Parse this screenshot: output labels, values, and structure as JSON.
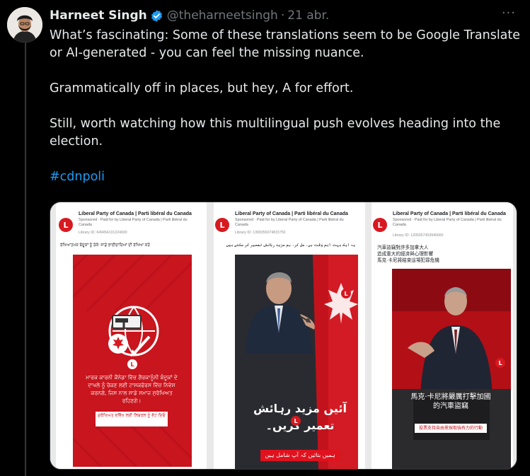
{
  "tweet": {
    "display_name": "Harneet Singh",
    "handle": "@theharneetsingh",
    "separator": "·",
    "time": "21 abr.",
    "more_icon": "···",
    "paragraphs": [
      "What’s fascinating: Some of these translations seem to be Google Translate or AI-generated - you can feel the missing nuance.",
      "Grammatically off in places, but hey, A for effort.",
      "Still, worth watching how this multilingual push evolves heading into the election."
    ],
    "hashtag": "#cdnpoli"
  },
  "ads": [
    {
      "advertiser": "Liberal Party of Canada | Parti libéral du Canada",
      "sponsored": "Sponsored · Paid for by Liberal Party of Canada | Parti libéral du Canada",
      "library_id": "Library ID: 649454101224000",
      "caption": "ਰੱਖਿਆਤਮਕ ਬੰਦੂਕਾਂ ਨੂੰ ਰੋਕੋ: ਸਾਡੇ ਭਾਈਚਾਰਿਆਂ ਦੀ ਰੱਖਿਆ ਕਰੋ",
      "creative_text": "ਮਾਰਕ ਕਾਰਨੀ ਕੈਨੇਡਾ ਵਿੱਚ ਗੈਰਕਾਨੂੰਨੀ ਬੰਦੂਕਾਂ ਦੇ ਦਾਖਲੇ ਨੂੰ ਰੋਕਣ ਲਈ ਟਾਸਕਫੋਰਸ ਵਿੱਚ ਨਿਵੇਸ਼ ਕਰਨਗੇ, ਜਿਸ ਨਾਲ ਸਾਡੇ ਸਮਾਜ ਸੁਰੱਖਿਅਤ ਰਹਿਣਗੇ।",
      "button_text": "ਸੁਰੱਖਿਅਤ ਭਵਿੱਖ ਲਈ ਲਿਬਰਲ ਨੂੰ ਵੋਟ ਦਿਓ"
    },
    {
      "advertiser": "Liberal Party of Canada | Parti libéral du Canada",
      "sponsored": "Sponsored · Paid for by Liberal Party of Canada | Parti libéral du Canada",
      "library_id": "Library ID: 1399356074815750",
      "caption": "یہ ایک بہت اہم وقت ہے۔ مل کر، ہم مزید رہائش تعمیر کر سکتے ہیں",
      "creative_text": "آئیں مزید رہائش تعمیر کریں۔",
      "button_text": "ہمیں بتائیں کہ آپ شامل ہیں"
    },
    {
      "advertiser": "Liberal Party of Canada | Parti libéral du Canada",
      "sponsored": "Sponsored · Paid for by Liberal Party of Canada | Parti libéral du Canada",
      "library_id": "Library ID: 1205057453945660",
      "caption_lines": [
        "汽車盜竊對許多加拿大人",
        "造成重大的經濟與心理影響",
        "馬克·卡尼將結束這場犯罪危機"
      ],
      "creative_text": "馬克·卡尼將嚴厲打擊加國的汽車盜竊",
      "button_text": "投票支持自由黨採取強有力的行動"
    }
  ],
  "colors": {
    "background": "#000000",
    "text": "#e7e9ea",
    "secondary": "#71767b",
    "link": "#1d9bf0",
    "liberal_red": "#d71920"
  }
}
